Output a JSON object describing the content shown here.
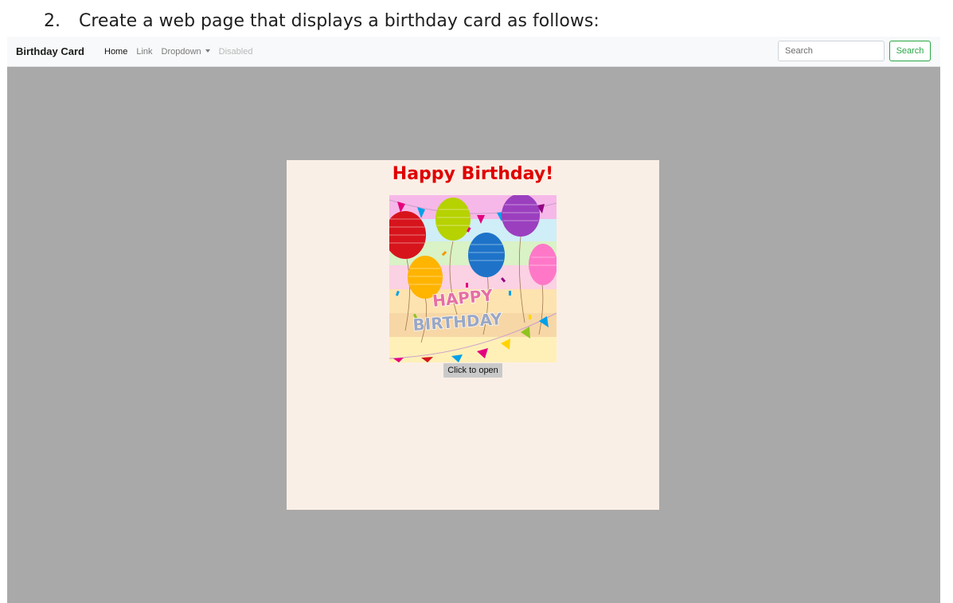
{
  "instruction": {
    "number": "2.",
    "text": "Create a web page that displays a birthday card as follows:"
  },
  "navbar": {
    "brand": "Birthday Card",
    "links": [
      {
        "label": "Home",
        "state": "active"
      },
      {
        "label": "Link",
        "state": "normal"
      },
      {
        "label": "Dropdown",
        "state": "dropdown"
      },
      {
        "label": "Disabled",
        "state": "disabled"
      }
    ],
    "search": {
      "placeholder": "Search",
      "value": "",
      "button_label": "Search"
    }
  },
  "card": {
    "title": "Happy Birthday!",
    "image_text": {
      "line1": "HAPPY",
      "line2": "BIRTHDAY"
    },
    "button_label": "Click to open"
  },
  "colors": {
    "page_background": "#a9a9a9",
    "card_background": "#faefe6",
    "title_color": "#e00000",
    "search_accent": "#28a745",
    "navbar_background": "#f8f9fa"
  }
}
